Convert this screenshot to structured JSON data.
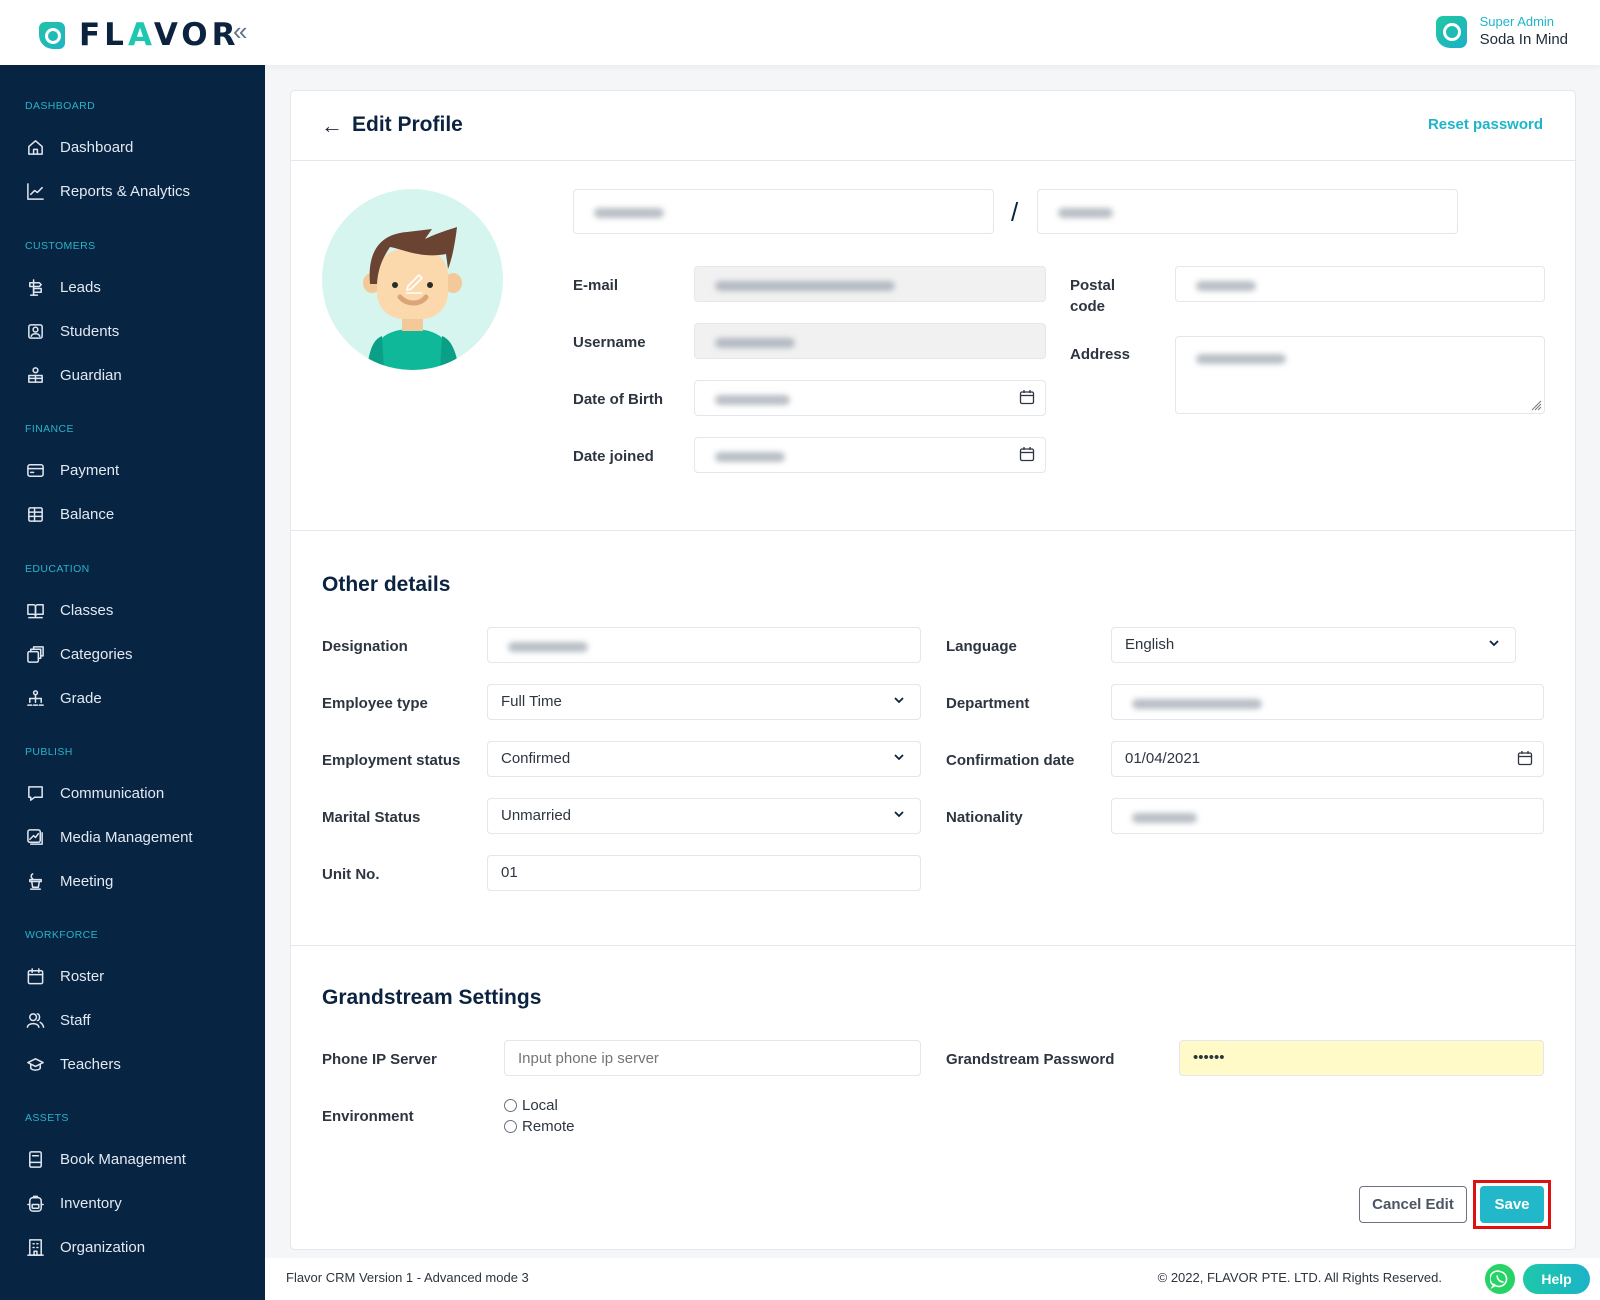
{
  "app": {
    "logo_text_1": "FL",
    "logo_text_accent": "A",
    "logo_text_2": "VOR",
    "collapse_icon": "double-chevron-left-icon"
  },
  "user": {
    "role": "Super Admin",
    "name": "Soda In Mind"
  },
  "sidebar": {
    "sections": [
      {
        "heading": "DASHBOARD",
        "items": [
          {
            "label": "Dashboard",
            "icon": "home-icon"
          },
          {
            "label": "Reports & Analytics",
            "icon": "chart-line-icon"
          }
        ]
      },
      {
        "heading": "CUSTOMERS",
        "items": [
          {
            "label": "Leads",
            "icon": "signpost-icon"
          },
          {
            "label": "Students",
            "icon": "user-square-icon"
          },
          {
            "label": "Guardian",
            "icon": "guardian-icon"
          }
        ]
      },
      {
        "heading": "FINANCE",
        "items": [
          {
            "label": "Payment",
            "icon": "credit-card-icon"
          },
          {
            "label": "Balance",
            "icon": "ledger-icon"
          }
        ]
      },
      {
        "heading": "EDUCATION",
        "items": [
          {
            "label": "Classes",
            "icon": "book-open-icon"
          },
          {
            "label": "Categories",
            "icon": "stack-icon"
          },
          {
            "label": "Grade",
            "icon": "hierarchy-icon"
          }
        ]
      },
      {
        "heading": "PUBLISH",
        "items": [
          {
            "label": "Communication",
            "icon": "chat-icon"
          },
          {
            "label": "Media Management",
            "icon": "image-stack-icon"
          },
          {
            "label": "Meeting",
            "icon": "podium-icon"
          }
        ]
      },
      {
        "heading": "WORKFORCE",
        "items": [
          {
            "label": "Roster",
            "icon": "calendar-icon"
          },
          {
            "label": "Staff",
            "icon": "users-icon"
          },
          {
            "label": "Teachers",
            "icon": "graduation-cap-icon"
          }
        ]
      },
      {
        "heading": "ASSETS",
        "items": [
          {
            "label": "Book Management",
            "icon": "book-icon"
          },
          {
            "label": "Inventory",
            "icon": "backpack-icon"
          },
          {
            "label": "Organization",
            "icon": "building-icon"
          }
        ]
      }
    ]
  },
  "page": {
    "title": "Edit Profile",
    "reset_password": "Reset password",
    "name_separator": "/"
  },
  "profile": {
    "email_label": "E-mail",
    "username_label": "Username",
    "dob_label": "Date of Birth",
    "date_joined_label": "Date joined",
    "postal_code_label": "Postal code",
    "address_label": "Address"
  },
  "other_details": {
    "title": "Other details",
    "designation_label": "Designation",
    "employee_type_label": "Employee type",
    "employee_type_value": "Full Time",
    "employment_status_label": "Employment status",
    "employment_status_value": "Confirmed",
    "marital_status_label": "Marital Status",
    "marital_status_value": "Unmarried",
    "unit_no_label": "Unit No.",
    "unit_no_value": "01",
    "language_label": "Language",
    "language_value": "English",
    "department_label": "Department",
    "confirmation_date_label": "Confirmation date",
    "confirmation_date_value": "01/04/2021",
    "nationality_label": "Nationality"
  },
  "grandstream": {
    "title": "Grandstream Settings",
    "phone_ip_label": "Phone IP Server",
    "phone_ip_placeholder": "Input phone ip server",
    "password_label": "Grandstream Password",
    "password_value": "••••••",
    "environment_label": "Environment",
    "environment_options": [
      "Local",
      "Remote"
    ]
  },
  "actions": {
    "cancel": "Cancel Edit",
    "save": "Save"
  },
  "footer": {
    "version": "Flavor CRM Version 1 - Advanced mode 3",
    "copyright": "© 2022, FLAVOR PTE. LTD. All Rights Reserved.",
    "help": "Help"
  }
}
